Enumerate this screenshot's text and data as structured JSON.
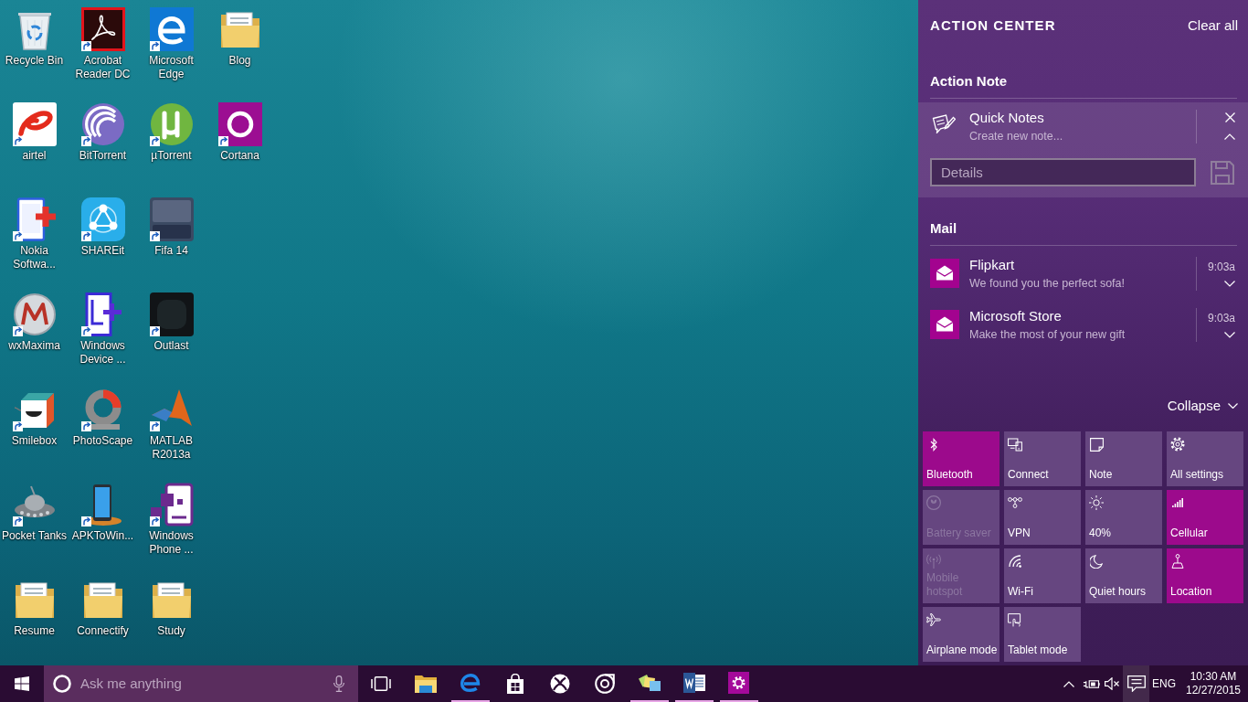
{
  "desktop_icons": [
    {
      "label": "Recycle Bin",
      "kind": "recycle",
      "shortcut": false
    },
    {
      "label": "airtel",
      "kind": "airtel",
      "shortcut": true
    },
    {
      "label": "Nokia Softwa...",
      "kind": "nokia",
      "shortcut": true
    },
    {
      "label": "wxMaxima",
      "kind": "maxima",
      "shortcut": true
    },
    {
      "label": "Smilebox",
      "kind": "smilebox",
      "shortcut": true
    },
    {
      "label": "Pocket Tanks",
      "kind": "tank",
      "shortcut": true
    },
    {
      "label": "Resume",
      "kind": "folder",
      "shortcut": false
    },
    {
      "label": "Acrobat Reader DC",
      "kind": "acrobat",
      "shortcut": true
    },
    {
      "label": "BitTorrent",
      "kind": "bittorrent",
      "shortcut": true
    },
    {
      "label": "SHAREit",
      "kind": "shareit",
      "shortcut": true
    },
    {
      "label": "Windows Device ...",
      "kind": "device",
      "shortcut": true
    },
    {
      "label": "PhotoScape",
      "kind": "photoscape",
      "shortcut": true
    },
    {
      "label": "APKToWin...",
      "kind": "apk",
      "shortcut": true
    },
    {
      "label": "Connectify",
      "kind": "folder",
      "shortcut": false
    },
    {
      "label": "Microsoft Edge",
      "kind": "edge",
      "shortcut": true
    },
    {
      "label": "µTorrent",
      "kind": "utorrent",
      "shortcut": true
    },
    {
      "label": "Fifa 14",
      "kind": "game",
      "shortcut": true
    },
    {
      "label": "Outlast",
      "kind": "dark",
      "shortcut": true
    },
    {
      "label": "MATLAB R2013a",
      "kind": "matlab",
      "shortcut": true
    },
    {
      "label": "Windows Phone ...",
      "kind": "phone",
      "shortcut": true
    },
    {
      "label": "Study",
      "kind": "folder",
      "shortcut": false
    },
    {
      "label": "Blog",
      "kind": "folder",
      "shortcut": false
    },
    {
      "label": "Cortana",
      "kind": "cortana",
      "shortcut": true
    }
  ],
  "action_center": {
    "title": "ACTION CENTER",
    "clear_all": "Clear all",
    "groups": [
      {
        "heading": "Action Note",
        "notifications": [
          {
            "kind": "note",
            "title": "Quick Notes",
            "text": "Create new note...",
            "expanded": true,
            "input": {
              "placeholder": "Details"
            }
          }
        ]
      },
      {
        "heading": "Mail",
        "notifications": [
          {
            "kind": "mail",
            "title": "Flipkart",
            "text": "We found you the perfect sofa!",
            "time": "9:03a",
            "expanded": false
          },
          {
            "kind": "mail",
            "title": "Microsoft Store",
            "text": "Make the most of your new gift",
            "time": "9:03a",
            "expanded": false
          }
        ]
      }
    ],
    "collapse": "Collapse",
    "quick_actions": [
      {
        "label": "Bluetooth",
        "kind": "bluetooth",
        "on": true,
        "disabled": false
      },
      {
        "label": "Connect",
        "kind": "connect",
        "on": false,
        "disabled": false
      },
      {
        "label": "Note",
        "kind": "note",
        "on": false,
        "disabled": false
      },
      {
        "label": "All settings",
        "kind": "settings",
        "on": false,
        "disabled": false
      },
      {
        "label": "Battery saver",
        "kind": "battery",
        "on": false,
        "disabled": true
      },
      {
        "label": "VPN",
        "kind": "vpn",
        "on": false,
        "disabled": false
      },
      {
        "label": "40%",
        "kind": "brightness",
        "on": false,
        "disabled": false
      },
      {
        "label": "Cellular",
        "kind": "cellular",
        "on": true,
        "disabled": false
      },
      {
        "label": "Mobile hotspot",
        "kind": "hotspot",
        "on": false,
        "disabled": true
      },
      {
        "label": "Wi-Fi",
        "kind": "wifi",
        "on": false,
        "disabled": false
      },
      {
        "label": "Quiet hours",
        "kind": "quiet",
        "on": false,
        "disabled": false
      },
      {
        "label": "Location",
        "kind": "location",
        "on": true,
        "disabled": false
      },
      {
        "label": "Airplane mode",
        "kind": "airplane",
        "on": false,
        "disabled": false
      },
      {
        "label": "Tablet mode",
        "kind": "tablet",
        "on": false,
        "disabled": false
      }
    ]
  },
  "taskbar": {
    "search": {
      "placeholder": "Ask me anything"
    },
    "apps": [
      {
        "kind": "task-view",
        "running": false
      },
      {
        "kind": "explorer",
        "running": false
      },
      {
        "kind": "browser",
        "running": true
      },
      {
        "kind": "store",
        "running": false
      },
      {
        "kind": "xbox",
        "running": false
      },
      {
        "kind": "music",
        "running": false
      },
      {
        "kind": "sticky-notes",
        "running": true
      },
      {
        "kind": "word",
        "running": true
      },
      {
        "kind": "settings",
        "running": true
      }
    ],
    "tray": {
      "volume_muted": true,
      "action_center_open": true,
      "language": "ENG",
      "time": "10:30 AM",
      "date": "12/27/2015"
    }
  }
}
